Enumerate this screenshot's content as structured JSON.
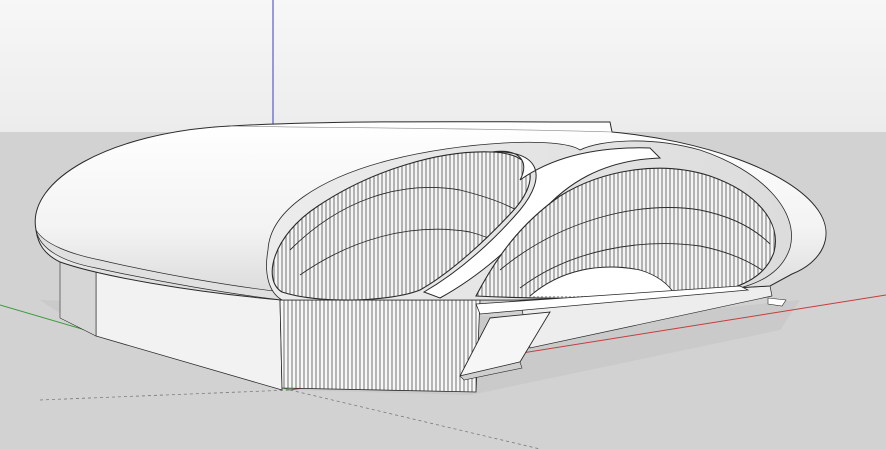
{
  "app": {
    "kind": "3d-modeling-viewport",
    "colors": {
      "sky": "#f4f4f4",
      "ground": "#d2d2d2",
      "model_fill": "#ffffff",
      "model_shadow": "#b9b9b9",
      "edge": "#2a2a2a",
      "axis_blue": "#3c3cc8",
      "axis_red": "#c83c3c",
      "axis_green": "#3c9c3c"
    },
    "icons": [
      "axis-origin-icon"
    ]
  }
}
